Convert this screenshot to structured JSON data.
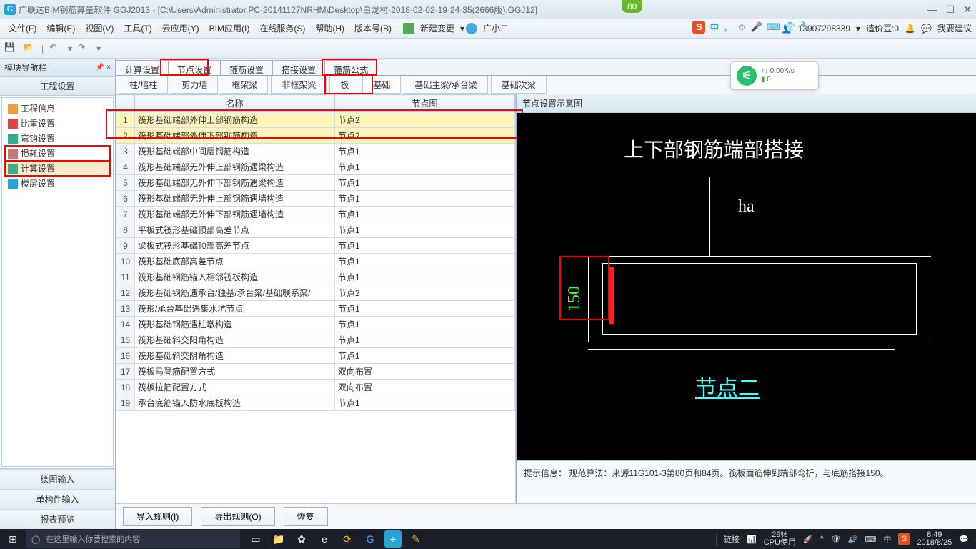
{
  "title": "广联达BIM钢筋算量软件 GGJ2013 - [C:\\Users\\Administrator.PC-20141127NRHM\\Desktop\\白龙村-2018-02-02-19-24-35(2666版).GGJ12]",
  "badge": "80",
  "menu": [
    "文件(F)",
    "编辑(E)",
    "视图(V)",
    "工具(T)",
    "云应用(Y)",
    "BIM应用(I)",
    "在线服务(S)",
    "帮助(H)",
    "版本号(B)"
  ],
  "menu_new": "新建变更",
  "menu_user": "广小二",
  "menu_phone": "13907298339",
  "menu_beans_label": "造价豆:0",
  "menu_feedback": "我要建议",
  "sogou_cn": "中",
  "left": {
    "panel_title": "模块导航栏",
    "section": "工程设置",
    "tree": [
      {
        "label": "工程信息",
        "ic": "#e9a23b"
      },
      {
        "label": "比重设置",
        "ic": "#d44"
      },
      {
        "label": "弯钩设置",
        "ic": "#3a8"
      },
      {
        "label": "损耗设置",
        "ic": "#c77"
      },
      {
        "label": "计算设置",
        "ic": "#4a8",
        "sel": true
      },
      {
        "label": "楼层设置",
        "ic": "#29a3d6"
      }
    ],
    "bottom": [
      "绘图输入",
      "单构件输入",
      "报表预览"
    ]
  },
  "tabs1": [
    "计算设置",
    "节点设置",
    "箍筋设置",
    "搭接设置",
    "箍筋公式"
  ],
  "tabs1_active": 1,
  "tabs2": [
    "柱/墙柱",
    "剪力墙",
    "框架梁",
    "非框架梁",
    "板",
    "基础",
    "基础主梁/承台梁",
    "基础次梁"
  ],
  "tabs2_active": 5,
  "grid_headers": [
    "",
    "名称",
    "节点图"
  ],
  "grid_rows": [
    {
      "n": 1,
      "name": "筏形基础端部外伸上部钢筋构造",
      "node": "节点2",
      "hl": true
    },
    {
      "n": 2,
      "name": "筏形基础端部外伸下部钢筋构造",
      "node": "节点2",
      "hl": true
    },
    {
      "n": 3,
      "name": "筏形基础端部中间层钢筋构造",
      "node": "节点1"
    },
    {
      "n": 4,
      "name": "筏形基础端部无外伸上部钢筋遇梁构造",
      "node": "节点1"
    },
    {
      "n": 5,
      "name": "筏形基础端部无外伸下部钢筋遇梁构造",
      "node": "节点1"
    },
    {
      "n": 6,
      "name": "筏形基础端部无外伸上部钢筋遇墙构造",
      "node": "节点1"
    },
    {
      "n": 7,
      "name": "筏形基础端部无外伸下部钢筋遇墙构造",
      "node": "节点1"
    },
    {
      "n": 8,
      "name": "平板式筏形基础顶部高差节点",
      "node": "节点1"
    },
    {
      "n": 9,
      "name": "梁板式筏形基础顶部高差节点",
      "node": "节点1"
    },
    {
      "n": 10,
      "name": "筏形基础底部高差节点",
      "node": "节点1"
    },
    {
      "n": 11,
      "name": "筏形基础钢筋锚入相邻筏板构造",
      "node": "节点1"
    },
    {
      "n": 12,
      "name": "筏形基础钢筋遇承台/独基/承台梁/基础联系梁/",
      "node": "节点2"
    },
    {
      "n": 13,
      "name": "筏形/承台基础遇集水坑节点",
      "node": "节点1"
    },
    {
      "n": 14,
      "name": "筏形基础钢筋遇柱墩构造",
      "node": "节点1"
    },
    {
      "n": 15,
      "name": "筏形基础斜交阳角构造",
      "node": "节点1"
    },
    {
      "n": 16,
      "name": "筏形基础斜交阴角构造",
      "node": "节点1"
    },
    {
      "n": 17,
      "name": "筏板马凳筋配置方式",
      "node": "双向布置"
    },
    {
      "n": 18,
      "name": "筏板拉筋配置方式",
      "node": "双向布置"
    },
    {
      "n": 19,
      "name": "承台底筋锚入防水底板构造",
      "node": "节点1"
    }
  ],
  "diagram": {
    "title": "节点设置示意图",
    "heading": "上下部钢筋端部搭接",
    "ha": "ha",
    "dim": "150",
    "node_label": "节点二",
    "hint_label": "提示信息：",
    "hint_text": "规范算法：来源11G101-3第80页和84页。筏板面筋伸到端部弯折，与底筋搭接150。"
  },
  "actions": {
    "import": "导入规则(I)",
    "export": "导出规则(O)",
    "restore": "恢复"
  },
  "net": {
    "speed": "0.00K/s",
    "batt": "0"
  },
  "taskbar": {
    "search": "在这里输入你要搜索的内容",
    "link": "链接",
    "cpu_pct": "29%",
    "cpu_label": "CPU使用",
    "ime": "中",
    "time": "8:49",
    "date": "2018/8/25"
  }
}
